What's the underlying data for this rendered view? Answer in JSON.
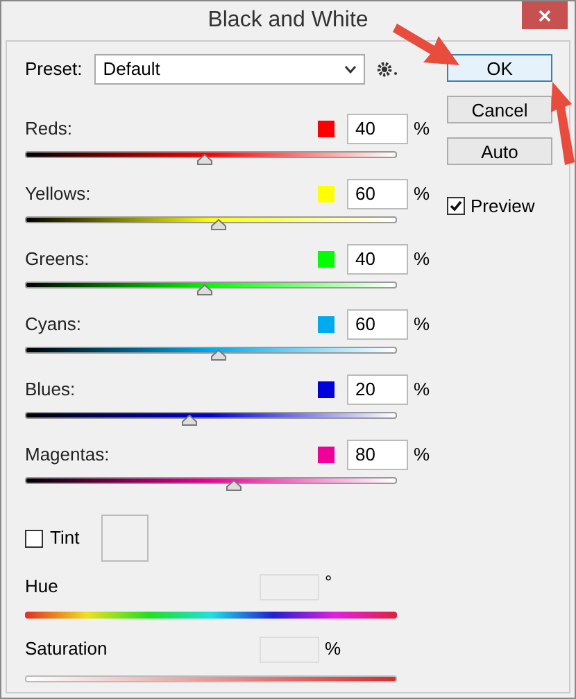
{
  "window": {
    "title": "Black and White"
  },
  "preset": {
    "label": "Preset:",
    "value": "Default"
  },
  "channels": [
    {
      "name": "Reds:",
      "color": "#ff0000",
      "value": "40",
      "unit": "%",
      "level": 0.48
    },
    {
      "name": "Yellows:",
      "color": "#ffff00",
      "value": "60",
      "unit": "%",
      "level": 0.52
    },
    {
      "name": "Greens:",
      "color": "#00ff00",
      "value": "40",
      "unit": "%",
      "level": 0.48
    },
    {
      "name": "Cyans:",
      "color": "#00aaee",
      "value": "60",
      "unit": "%",
      "level": 0.52
    },
    {
      "name": "Blues:",
      "color": "#0000dd",
      "value": "20",
      "unit": "%",
      "level": 0.44
    },
    {
      "name": "Magentas:",
      "color": "#ee0099",
      "value": "80",
      "unit": "%",
      "level": 0.56
    }
  ],
  "tint": {
    "label": "Tint",
    "checked": false
  },
  "hue": {
    "label": "Hue",
    "unit": "°"
  },
  "saturation": {
    "label": "Saturation",
    "unit": "%"
  },
  "buttons": [
    {
      "label": "OK",
      "focused": true
    },
    {
      "label": "Cancel",
      "focused": false
    },
    {
      "label": "Auto",
      "focused": false
    }
  ],
  "preview": {
    "label": "Preview",
    "checked": true
  }
}
